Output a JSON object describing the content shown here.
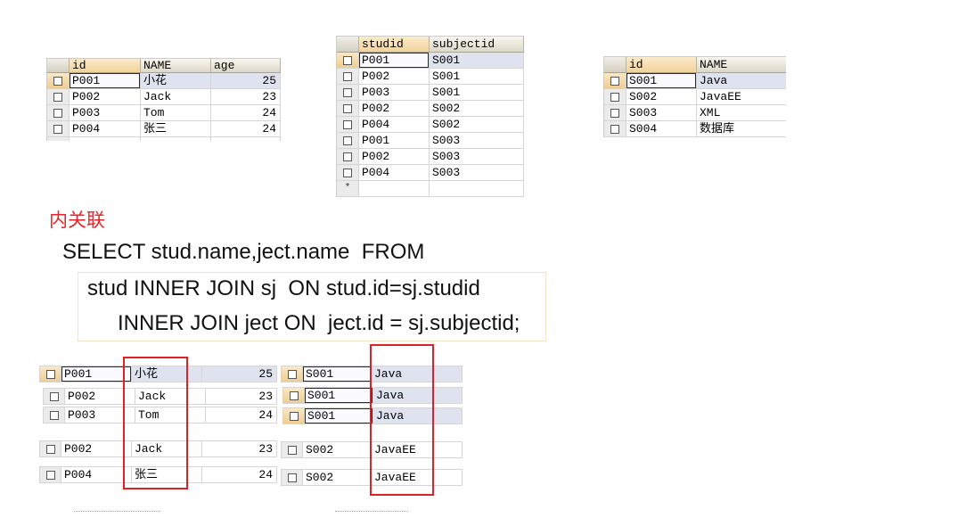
{
  "stud_grid": {
    "columns": [
      "id",
      "NAME",
      "age"
    ],
    "rows": [
      [
        "P001",
        "小花",
        "25"
      ],
      [
        "P002",
        "Jack",
        "23"
      ],
      [
        "P003",
        "Tom",
        "24"
      ],
      [
        "P004",
        "张三",
        "24"
      ]
    ]
  },
  "sj_grid": {
    "columns": [
      "studid",
      "subjectid"
    ],
    "rows": [
      [
        "P001",
        "S001"
      ],
      [
        "P002",
        "S001"
      ],
      [
        "P003",
        "S001"
      ],
      [
        "P002",
        "S002"
      ],
      [
        "P004",
        "S002"
      ],
      [
        "P001",
        "S003"
      ],
      [
        "P002",
        "S003"
      ],
      [
        "P004",
        "S003"
      ]
    ],
    "new_row_marker": "*"
  },
  "ject_grid": {
    "columns": [
      "id",
      "NAME"
    ],
    "rows": [
      [
        "S001",
        "Java"
      ],
      [
        "S002",
        "JavaEE"
      ],
      [
        "S003",
        "XML"
      ],
      [
        "S004",
        "数据库"
      ]
    ]
  },
  "join_title": "内关联",
  "sql": {
    "line1": "SELECT stud.name,ject.name  FROM",
    "line2": "stud INNER JOIN sj  ON stud.id=sj.studid",
    "line3": "INNER JOIN ject ON  ject.id = sj.subjectid;"
  },
  "result": {
    "stud_rows": [
      [
        "P001",
        "小花",
        "25"
      ],
      [
        "P002",
        "Jack",
        "23"
      ],
      [
        "P003",
        "Tom",
        "24"
      ],
      [
        "P002",
        "Jack",
        "23"
      ],
      [
        "P004",
        "张三",
        "24"
      ]
    ],
    "ject_rows": [
      [
        "S001",
        "Java"
      ],
      [
        "S001",
        "Java"
      ],
      [
        "S001",
        "Java"
      ],
      [
        "S002",
        "JavaEE"
      ],
      [
        "S002",
        "JavaEE"
      ]
    ]
  },
  "icons": {
    "row_selector": "checkbox-square-icon"
  },
  "colors": {
    "annotation_red": "#e21f26",
    "title_red": "#e8262b",
    "row_highlight": "#dfe3ef",
    "sorted_header": "#f2d29a"
  }
}
